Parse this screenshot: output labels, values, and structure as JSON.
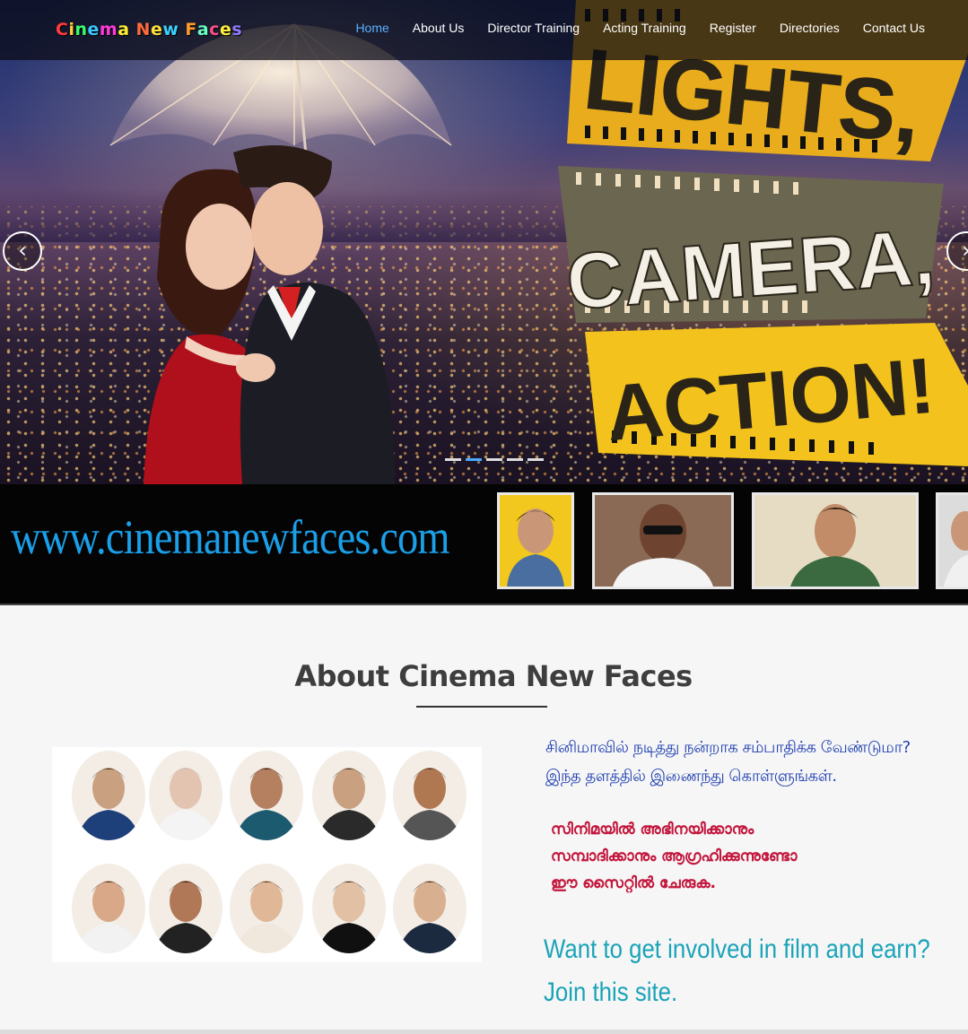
{
  "site": {
    "logo_letters": [
      {
        "ch": "C",
        "color": "#ff3b3b"
      },
      {
        "ch": "i",
        "color": "#ffd23b"
      },
      {
        "ch": "n",
        "color": "#3bff6a"
      },
      {
        "ch": "e",
        "color": "#3bc8ff"
      },
      {
        "ch": "m",
        "color": "#ff3bd6"
      },
      {
        "ch": "a",
        "color": "#ffee33"
      },
      {
        "ch": " ",
        "color": "#ffffff"
      },
      {
        "ch": "N",
        "color": "#ff6a3b"
      },
      {
        "ch": "e",
        "color": "#ffe13b"
      },
      {
        "ch": "w",
        "color": "#3bd0ff"
      },
      {
        "ch": " ",
        "color": "#ffffff"
      },
      {
        "ch": "F",
        "color": "#ff9b2b"
      },
      {
        "ch": "a",
        "color": "#6affc8"
      },
      {
        "ch": "c",
        "color": "#ff4f8a"
      },
      {
        "ch": "e",
        "color": "#ffef3b"
      },
      {
        "ch": "s",
        "color": "#8f7bff"
      }
    ]
  },
  "nav": {
    "items": [
      "Home",
      "About Us",
      "Director Training",
      "Acting Training",
      "Register",
      "Directories",
      "Contact Us"
    ],
    "active": "Home"
  },
  "hero": {
    "slogan_words": [
      "LIGHTS,",
      "CAMERA,",
      "ACTION!"
    ],
    "prev_glyph": "‹",
    "next_glyph": "›",
    "slide_count": 5,
    "active_slide": 2
  },
  "band": {
    "url_text": "www.cinemanewfaces.com"
  },
  "about": {
    "title": "About Cinema New Faces",
    "tamil_lines": [
      "சினிமாவில் நடித்து நன்றாக சம்பாதிக்க வேண்டுமா?",
      "இந்த தளத்தில் இணைந்து கொள்ளுங்கள்."
    ],
    "malayalam_lines": [
      "സിനിമയിൽ അഭിനയിക്കാനും",
      "സമ്പാദിക്കാനും ആഗ്രഹിക്കുന്നുണ്ടോ",
      "ഈ സൈറ്റിൽ ചേരുക."
    ],
    "english_lines": [
      "Want to get involved in film and earn?",
      "Join this site."
    ]
  },
  "colors": {
    "accent_blue": "#1a9fe8",
    "active_nav": "#5ab0ff",
    "tamil_text": "#1f3fb0",
    "malayalam_text": "#c2163c",
    "english_text": "#1aa3b8"
  }
}
